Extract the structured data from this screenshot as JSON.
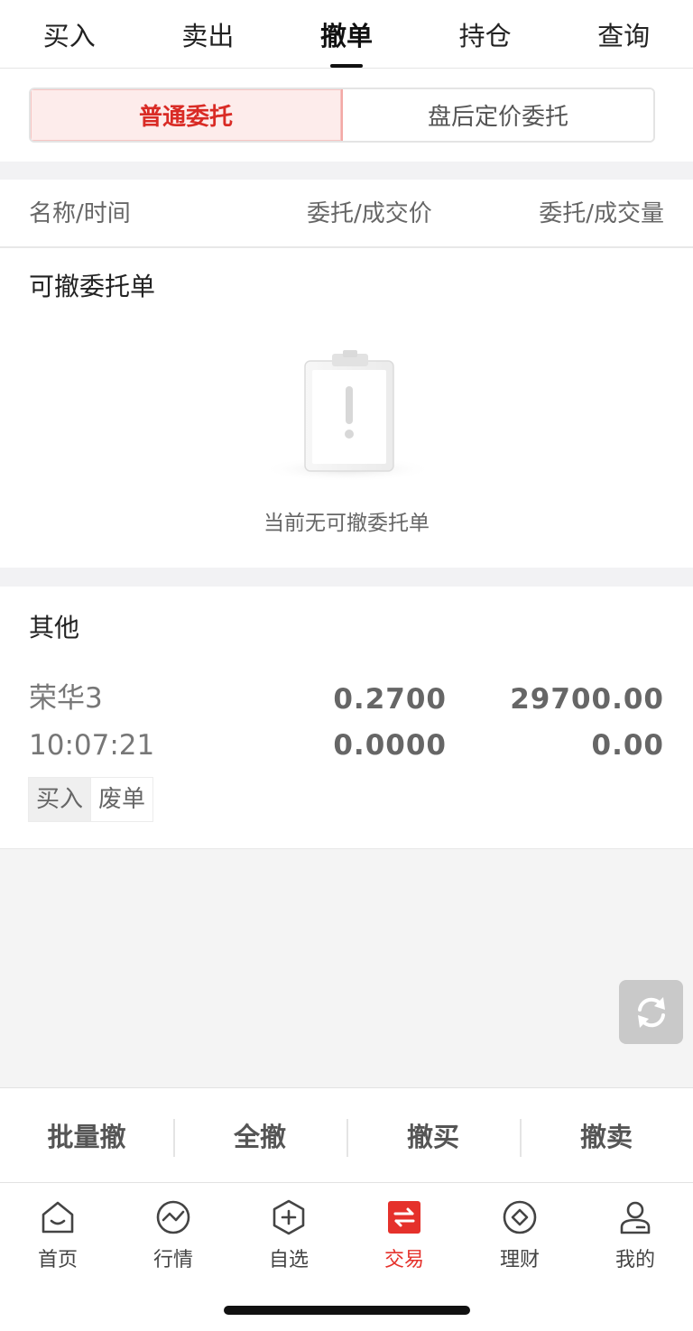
{
  "top_tabs": [
    {
      "label": "买入"
    },
    {
      "label": "卖出"
    },
    {
      "label": "撤单"
    },
    {
      "label": "持仓"
    },
    {
      "label": "查询"
    }
  ],
  "segmented": {
    "normal": "普通委托",
    "after_hours": "盘后定价委托"
  },
  "table_header": {
    "name_time": "名称/时间",
    "price": "委托/成交价",
    "volume": "委托/成交量"
  },
  "cancellable": {
    "title": "可撤委托单",
    "empty_text": "当前无可撤委托单"
  },
  "other": {
    "title": "其他",
    "orders": [
      {
        "name": "荣华3",
        "time": "10:07:21",
        "order_price": "0.2700",
        "deal_price": "0.0000",
        "order_volume": "29700.00",
        "deal_volume": "0.00",
        "side": "买入",
        "status": "废单"
      }
    ]
  },
  "actions": {
    "batch": "批量撤",
    "all": "全撤",
    "buy": "撤买",
    "sell": "撤卖"
  },
  "bottom_nav": [
    {
      "label": "首页",
      "icon": "home-icon"
    },
    {
      "label": "行情",
      "icon": "market-icon"
    },
    {
      "label": "自选",
      "icon": "watchlist-icon"
    },
    {
      "label": "交易",
      "icon": "trade-icon"
    },
    {
      "label": "理财",
      "icon": "wealth-icon"
    },
    {
      "label": "我的",
      "icon": "profile-icon"
    }
  ],
  "colors": {
    "accent": "#e5312b",
    "segment_active_bg": "#fdeceb"
  }
}
